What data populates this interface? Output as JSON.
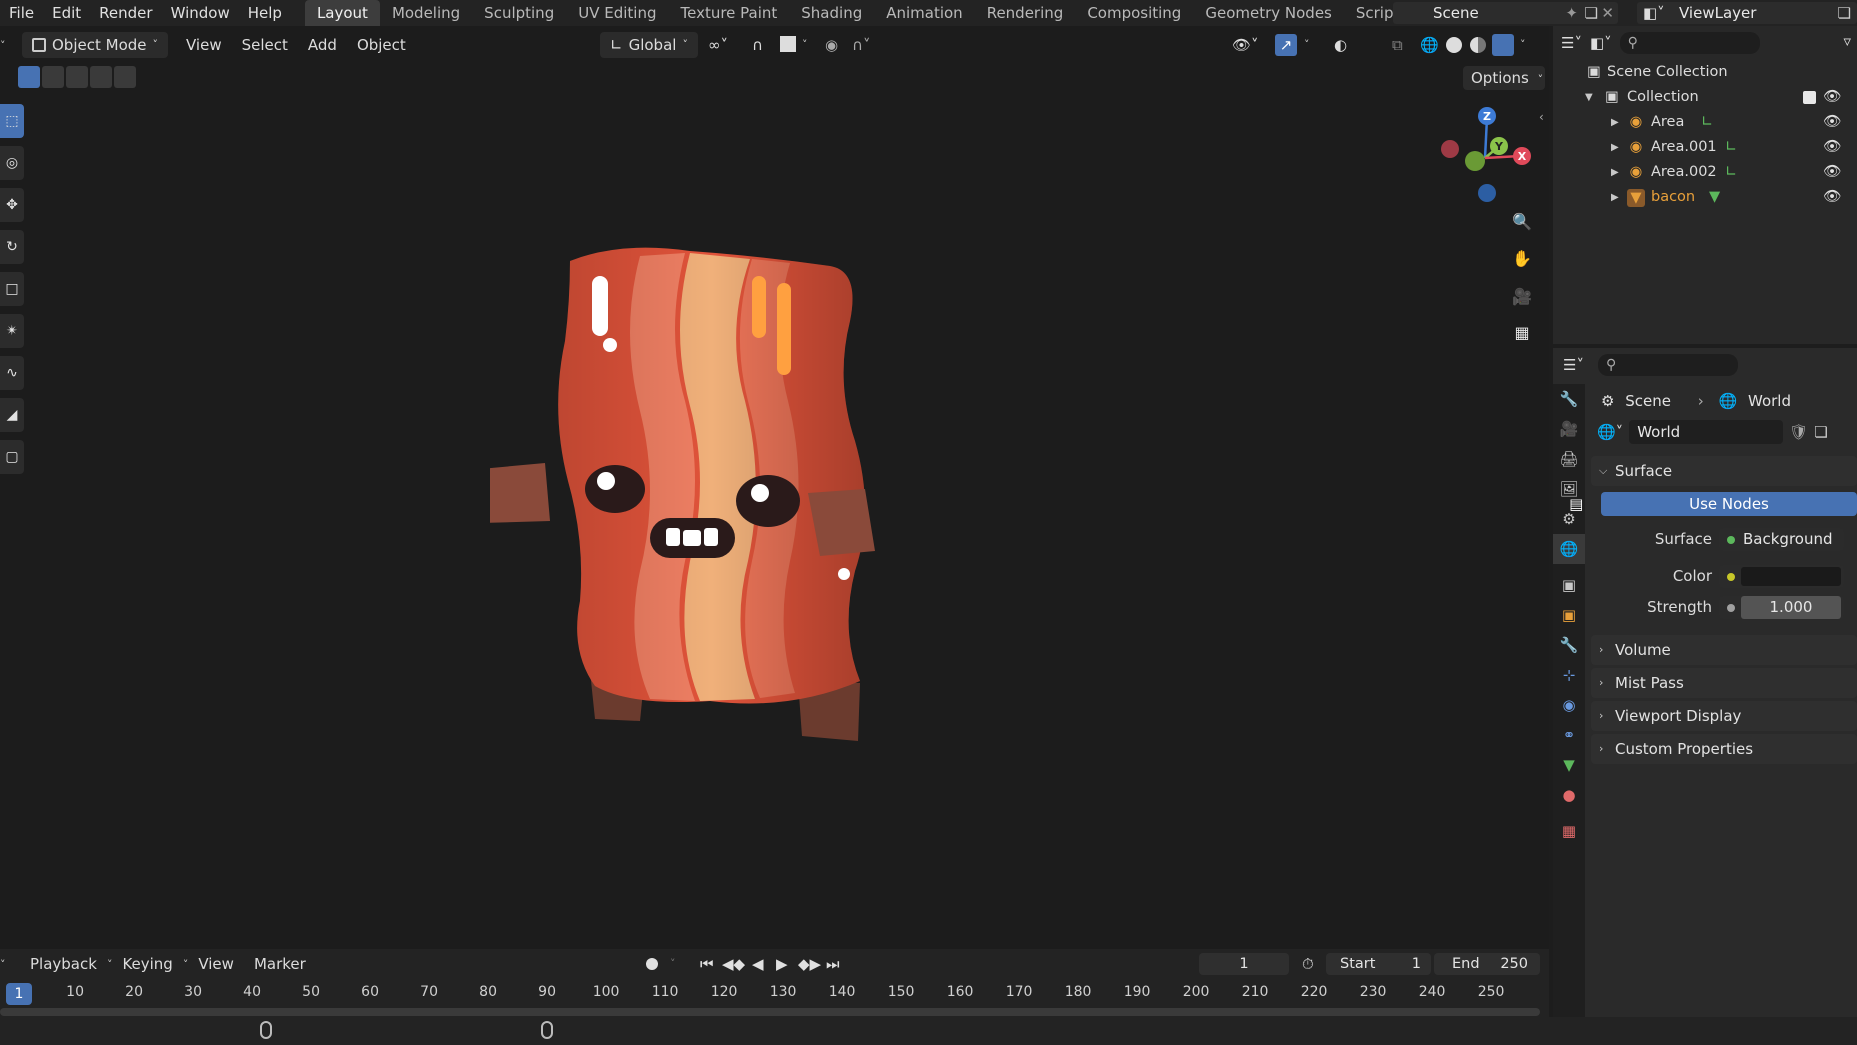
{
  "topbar": {
    "menus": [
      "File",
      "Edit",
      "Render",
      "Window",
      "Help"
    ],
    "workspaces": [
      "Layout",
      "Modeling",
      "Sculpting",
      "UV Editing",
      "Texture Paint",
      "Shading",
      "Animation",
      "Rendering",
      "Compositing",
      "Geometry Nodes",
      "Scripting"
    ],
    "active_workspace": "Layout",
    "scene_name": "Scene",
    "view_layer": "ViewLayer"
  },
  "viewport": {
    "mode": "Object Mode",
    "menus": [
      "View",
      "Select",
      "Add",
      "Object"
    ],
    "transform_orientation": "Global",
    "options_label": "Options",
    "gizmo_axes": [
      "Z",
      "Y",
      "X"
    ]
  },
  "outliner": {
    "root": "Scene Collection",
    "collection": "Collection",
    "items": [
      {
        "name": "Area",
        "type": "light"
      },
      {
        "name": "Area.001",
        "type": "light"
      },
      {
        "name": "Area.002",
        "type": "light"
      },
      {
        "name": "bacon",
        "type": "mesh",
        "active": true
      }
    ]
  },
  "properties": {
    "breadcrumb": [
      "Scene",
      "World"
    ],
    "world_name": "World",
    "surface_panel": "Surface",
    "use_nodes_label": "Use Nodes",
    "surface_label": "Surface",
    "surface_value": "Background",
    "color_label": "Color",
    "strength_label": "Strength",
    "strength_value": "1.000",
    "collapsed_panels": [
      "Volume",
      "Mist Pass",
      "Viewport Display",
      "Custom Properties"
    ]
  },
  "timeline": {
    "menus": [
      "Playback",
      "Keying",
      "View",
      "Marker"
    ],
    "current_frame": "1",
    "start_label": "Start",
    "start_value": "1",
    "end_label": "End",
    "end_value": "250",
    "ruler_ticks": [
      "1",
      "10",
      "20",
      "30",
      "40",
      "50",
      "60",
      "70",
      "80",
      "90",
      "100",
      "110",
      "120",
      "130",
      "140",
      "150",
      "160",
      "170",
      "180",
      "190",
      "200",
      "210",
      "220",
      "230",
      "240",
      "250"
    ]
  },
  "colors": {
    "accent": "#4772b3",
    "background": "#1c1c1c",
    "active_object": "#e8a03a"
  }
}
